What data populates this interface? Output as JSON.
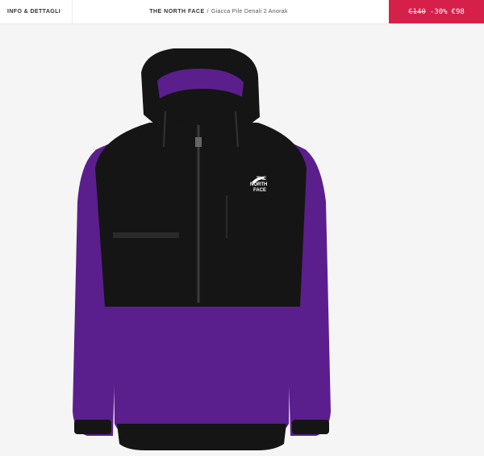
{
  "header": {
    "info_label": "INFO & DETTAGLI",
    "brand": "THE NORTH FACE",
    "separator": "/",
    "product": "Giacca Pile Denali 2 Anorak"
  },
  "price": {
    "original": "€140",
    "discount": "-30%",
    "current": "€98",
    "accent_color": "#d6204a"
  },
  "product_image": {
    "logo_lines": [
      "THE",
      "NORTH",
      "FACE"
    ],
    "colors": {
      "fleece": "#5a1f8c",
      "shell": "#151515"
    }
  }
}
